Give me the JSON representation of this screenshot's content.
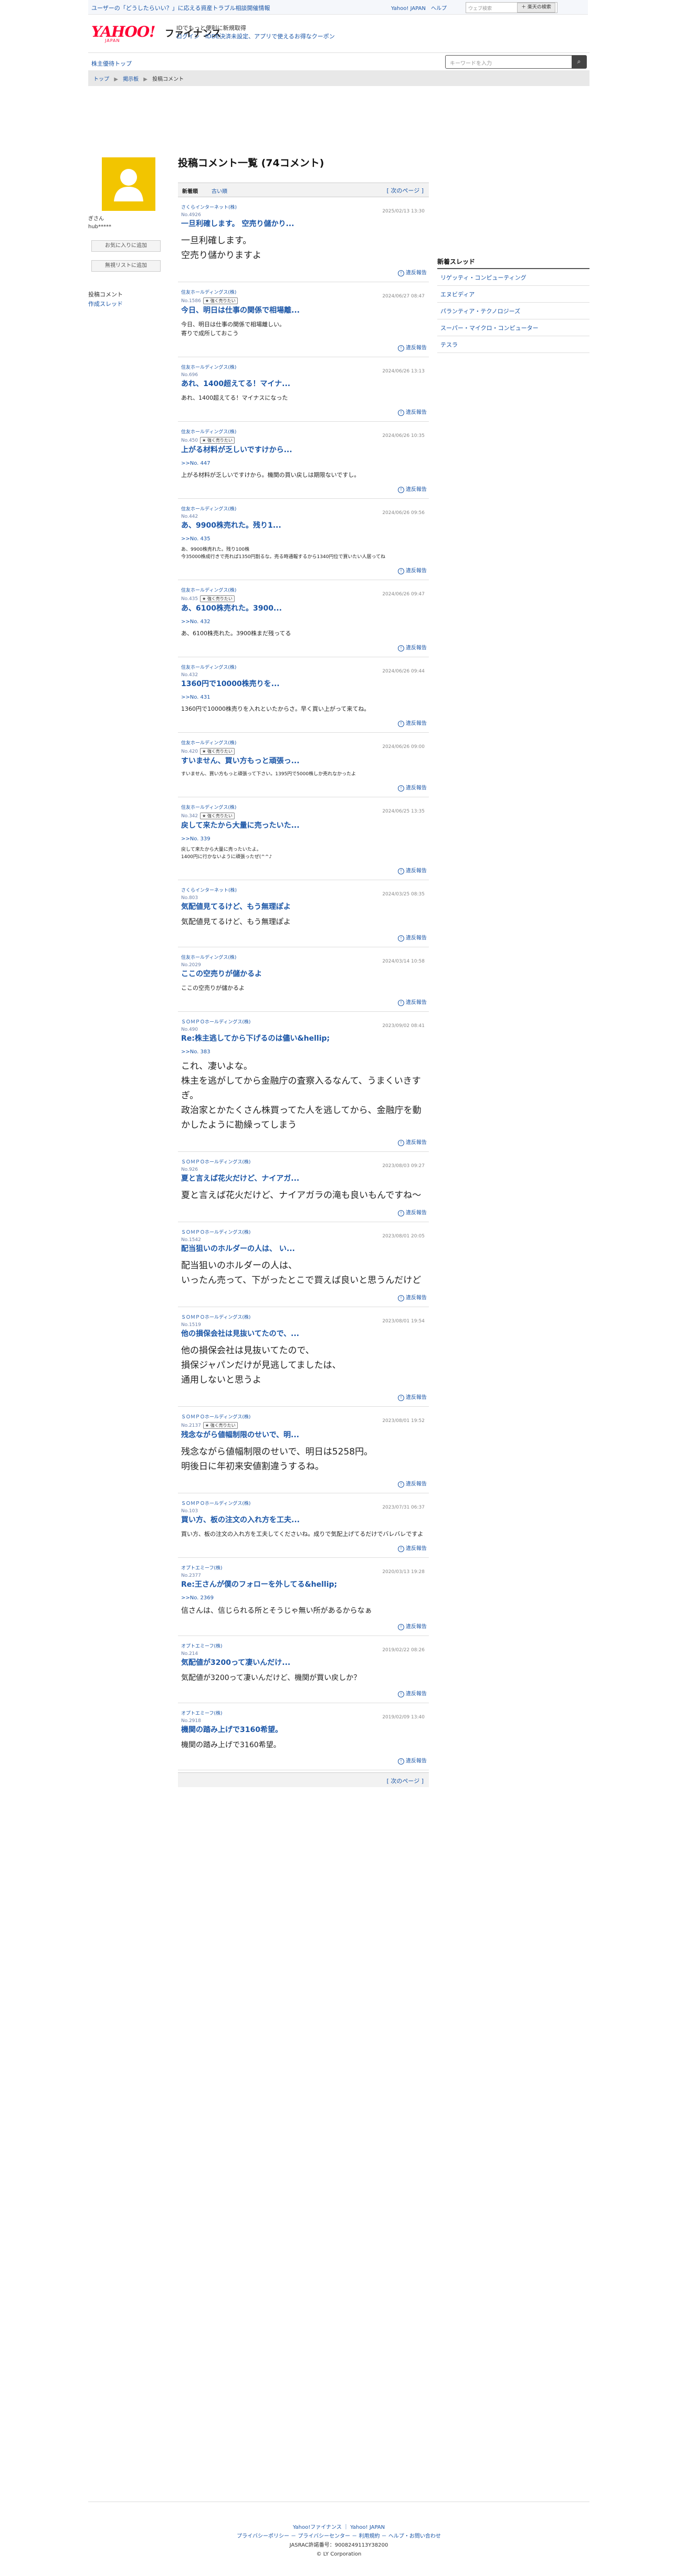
{
  "topbar": {
    "promo": "ユーザーの「どうしたらいい？」に応える資産トラブル相談開催情報",
    "links": "Yahoo! JAPAN　ヘルプ",
    "search_placeholder": "ウェブ検索",
    "search_button": "＋ 楽天の検索"
  },
  "header": {
    "logo": "YAHOO!",
    "logo_sub": "JAPAN",
    "service": "ファイナンス",
    "line1": "IDでもっと便利に新規取得",
    "line2": "ログイン　IDDE決済未設定、アプリで使えるお得なクーポン"
  },
  "nav": {
    "home": "株主優待トップ",
    "search_placeholder": "キーワードを入力"
  },
  "breadcrumb": [
    "トップ",
    "掲示板",
    "投稿コメント"
  ],
  "profile": {
    "name_label": "ぎさん",
    "id": "hub*****",
    "btn_favorite": "お気に入りに追加",
    "btn_ignore": "無視リストに追加",
    "nav_comments": "投稿コメント",
    "nav_threads": "作成スレッド"
  },
  "main": {
    "title": "投稿コメント一覧 (74コメント)",
    "sort_new": "新着順",
    "sort_old": "古い順",
    "next_page": "[ 次のページ ]",
    "report_label": "違反報告"
  },
  "posts": [
    {
      "company": "さくらインターネット(株)",
      "no": "No.4926",
      "badge": "",
      "date": "2025/02/13 13:30",
      "title": "一旦利確します。 空売り儲かり...",
      "reply": "",
      "body": "一旦利確します。\n空売り儲かりますよ",
      "size": "l"
    },
    {
      "company": "住友ホールディングス(株)",
      "no": "No.1586",
      "badge": "★ 強く売りたい",
      "date": "2024/06/27 08:47",
      "title": "今日、明日は仕事の関係で相場離...",
      "reply": "",
      "body": "今日、明日は仕事の関係で相場離しい。\n寄りで成所しておこう",
      "size": "s"
    },
    {
      "company": "住友ホールディングス(株)",
      "no": "No.696",
      "badge": "",
      "date": "2024/06/26 13:13",
      "title": "あれ、1400超えてる！マイナ...",
      "reply": "",
      "body": "あれ、1400超えてる！マイナスになった",
      "size": "s"
    },
    {
      "company": "住友ホールディングス(株)",
      "no": "No.450",
      "badge": "★ 強く売りたい",
      "date": "2024/06/26 10:35",
      "title": "上がる材料が乏しいですけから...",
      "reply": ">>No. 447",
      "body": "上がる材料が乏しいですけから。機関の買い戻しは期限ないですし。",
      "size": "s"
    },
    {
      "company": "住友ホールディングス(株)",
      "no": "No.442",
      "badge": "",
      "date": "2024/06/26 09:56",
      "title": "あ、9900株売れた。残り1...",
      "reply": ">>No. 435",
      "body": "あ、9900株売れた。残り100株\n今35000株成行きで売れば1350円割るな。売る時通報するから1340円位で買いたい人居ってね",
      "size": "xs"
    },
    {
      "company": "住友ホールディングス(株)",
      "no": "No.435",
      "badge": "★ 強く売りたい",
      "date": "2024/06/26 09:47",
      "title": "あ、6100株売れた。3900...",
      "reply": ">>No. 432",
      "body": "あ、6100株売れた。3900株まだ残ってる",
      "size": "s"
    },
    {
      "company": "住友ホールディングス(株)",
      "no": "No.432",
      "badge": "",
      "date": "2024/06/26 09:44",
      "title": "1360円で10000株売りを...",
      "reply": ">>No. 431",
      "body": "1360円で10000株売りを入れといたからさ。早く買い上がって来てね。",
      "size": "s"
    },
    {
      "company": "住友ホールディングス(株)",
      "no": "No.420",
      "badge": "★ 強く売りたい",
      "date": "2024/06/26 09:00",
      "title": "すいません、買い方もっと頑張っ...",
      "reply": "",
      "body": "すいません、買い方もっと頑張って下さい。1395円で5000株しか売れなかったよ",
      "size": "xs"
    },
    {
      "company": "住友ホールディングス(株)",
      "no": "No.342",
      "badge": "★ 強く売りたい",
      "date": "2024/06/25 13:35",
      "title": "戻して来たから大量に売ったいた...",
      "reply": ">>No. 339",
      "body": "戻して来たから大量に売ったいたよ。\n1400円に行かないように頑張ったぜ(^^♪",
      "size": "xs"
    },
    {
      "company": "さくらインターネット(株)",
      "no": "No.803",
      "badge": "",
      "date": "2024/03/25 08:35",
      "title": "気配値見てるけど、もう無理ぽよ",
      "reply": "",
      "body": "気配値見てるけど、もう無理ぽよ",
      "size": "m"
    },
    {
      "company": "住友ホールディングス(株)",
      "no": "No.2029",
      "badge": "",
      "date": "2024/03/14 10:58",
      "title": "ここの空売りが儲かるよ",
      "reply": "",
      "body": "ここの空売りが儲かるよ",
      "size": "s"
    },
    {
      "company": "ＳＯＭＰＯホールディングス(株)",
      "no": "No.490",
      "badge": "",
      "date": "2023/09/02 08:41",
      "title": "Re:株主逃してから下げるのは儘い&hellip;",
      "reply": ">>No. 383",
      "body": "これ、凄いよな。\n株主を逃がしてから金融庁の査察入るなんて、うまくいきすぎ。\n政治家とかたくさん株買ってた人を逃してから、金融庁を動かしたように勘繰ってしまう",
      "size": "l"
    },
    {
      "company": "ＳＯＭＰＯホールディングス(株)",
      "no": "No.926",
      "badge": "",
      "date": "2023/08/03 09:27",
      "title": "夏と言えば花火だけど、ナイアガ...",
      "reply": "",
      "body": "夏と言えば花火だけど、ナイアガラの滝も良いもんですね〜",
      "size": "l"
    },
    {
      "company": "ＳＯＭＰＯホールディングス(株)",
      "no": "No.1542",
      "badge": "",
      "date": "2023/08/01 20:05",
      "title": "配当狙いのホルダーの人は、 い...",
      "reply": "",
      "body": "配当狙いのホルダーの人は、\nいったん売って、下がったとこで買えば良いと思うんだけど",
      "size": "l"
    },
    {
      "company": "ＳＯＭＰＯホールディングス(株)",
      "no": "No.1519",
      "badge": "",
      "date": "2023/08/01 19:54",
      "title": "他の損保会社は見抜いてたので、...",
      "reply": "",
      "body": "他の損保会社は見抜いてたので、\n損保ジャパンだけが見逃してましたは、\n通用しないと思うよ",
      "size": "l"
    },
    {
      "company": "ＳＯＭＰＯホールディングス(株)",
      "no": "No.2137",
      "badge": "★ 強く売りたい",
      "date": "2023/08/01 19:52",
      "title": "残念ながら値幅制限のせいで、明...",
      "reply": "",
      "body": "残念ながら値幅制限のせいで、明日は5258円。\n明後日に年初来安値割違うするね。",
      "size": "l"
    },
    {
      "company": "ＳＯＭＰＯホールディングス(株)",
      "no": "No.103",
      "badge": "",
      "date": "2023/07/31 06:37",
      "title": "買い方、板の注文の入れ方を工夫...",
      "reply": "",
      "body": "買い方、板の注文の入れ方を工夫してくださいね。成りで気配上げてるだけでバレバレですよ",
      "size": "s"
    },
    {
      "company": "オプトエミーフ(株)",
      "no": "No.2377",
      "badge": "",
      "date": "2020/03/13 19:28",
      "title": "Re:王さんが僕のフォローを外してる&hellip;",
      "reply": ">>No. 2369",
      "body": "信さんは、信じられる所とそうじゃ無い所があるからなぁ",
      "size": "m"
    },
    {
      "company": "オプトエミーフ(株)",
      "no": "No.214",
      "badge": "",
      "date": "2019/02/22 08:26",
      "title": "気配値が3200って凄いんだけ...",
      "reply": "",
      "body": "気配値が3200って凄いんだけど、機関が買い戻しか？",
      "size": "m"
    },
    {
      "company": "オプトエミーフ(株)",
      "no": "No.2918",
      "badge": "",
      "date": "2019/02/09 13:40",
      "title": "機関の踏み上げで3160希望。",
      "reply": "",
      "body": "機関の踏み上げで3160希望。",
      "size": "m"
    }
  ],
  "sidebar": {
    "heading": "新着スレッド",
    "items": [
      "リゲッティ・コンピューティング",
      "エヌビディア",
      "パランティア・テクノロジーズ",
      "スーパー・マイクロ・コンピューター",
      "テスラ"
    ]
  },
  "footer": {
    "line1": "Yahoo!ファイナンス ｜ Yahoo! JAPAN",
    "line2": "プライバシーポリシー － プライバシーセンター － 利用規約 － ヘルプ・お問い合わせ",
    "line3": "JASRAC許諾番号：9008249113Y38200",
    "line4": "© LY Corporation"
  }
}
